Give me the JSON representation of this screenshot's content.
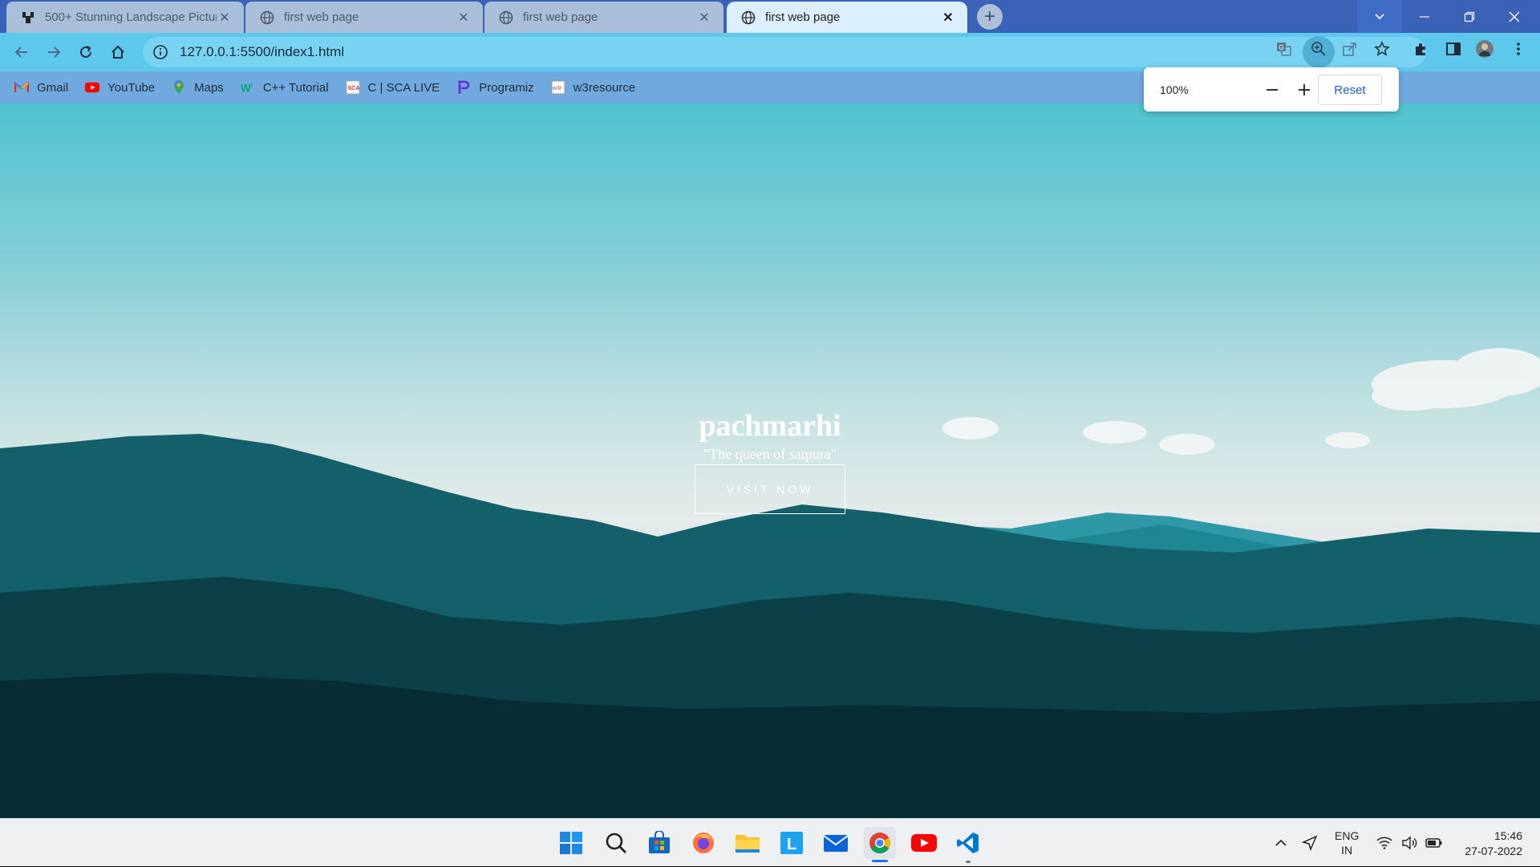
{
  "tabs": [
    {
      "title": "500+ Stunning Landscape Pictur",
      "active": false
    },
    {
      "title": "first web page",
      "active": false
    },
    {
      "title": "first web page",
      "active": false
    },
    {
      "title": "first web page",
      "active": true
    }
  ],
  "toolbar": {
    "url": "127.0.0.1:5500/index1.html"
  },
  "bookmarks": [
    {
      "label": "Gmail",
      "icon": "gmail-icon"
    },
    {
      "label": "YouTube",
      "icon": "youtube-icon"
    },
    {
      "label": "Maps",
      "icon": "maps-icon"
    },
    {
      "label": "C++ Tutorial",
      "icon": "w3-icon"
    },
    {
      "label": "C | SCA LIVE",
      "icon": "sca-icon"
    },
    {
      "label": "Programiz",
      "icon": "programiz-icon"
    },
    {
      "label": "w3resource",
      "icon": "w3resource-icon"
    }
  ],
  "zoom_popup": {
    "level": "100%",
    "reset_label": "Reset"
  },
  "hero": {
    "title": "pachmarhi",
    "subtitle": "\"The queen of satpura\"",
    "button_label": "VISIT NOW"
  },
  "taskbar": {
    "apps": [
      "start",
      "search",
      "store",
      "firefox",
      "file-explorer",
      "l-app",
      "mail",
      "chrome",
      "youtube",
      "vscode"
    ],
    "lang_line1": "ENG",
    "lang_line2": "IN",
    "time": "15:46",
    "date": "27-07-2022"
  },
  "colors": {
    "titlebar": "#3a63b8",
    "toolbar": "#5ec7ec",
    "bookmarks_bar": "#6fa9dd",
    "reset_text": "#1a5fc8"
  }
}
